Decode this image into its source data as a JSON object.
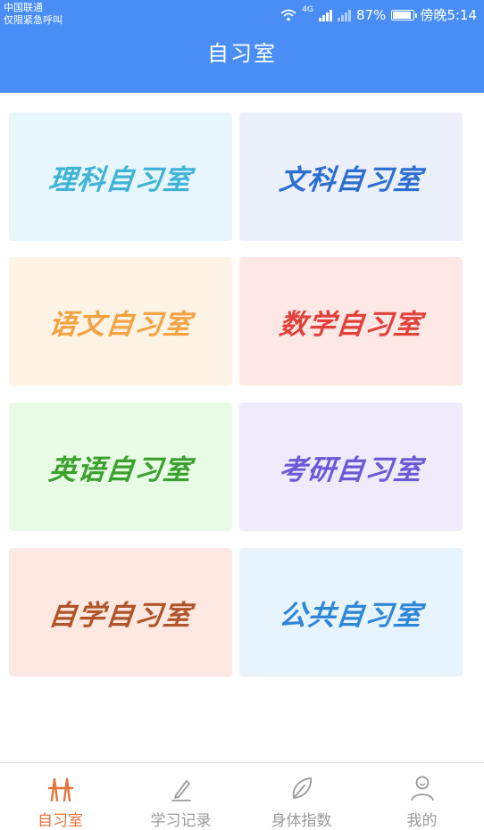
{
  "status_bar": {
    "carrier": "中国联通",
    "emergency": "仅限紧急呼叫",
    "network": "4G",
    "battery": "87%",
    "time": "傍晚5:14"
  },
  "header": {
    "title": "自习室"
  },
  "rooms": [
    {
      "label": "理科自习室",
      "color": "#3fb3d6",
      "bg": "#e7f6fd"
    },
    {
      "label": "文科自习室",
      "color": "#2c6fd1",
      "bg": "#ecf0fb"
    },
    {
      "label": "语文自习室",
      "color": "#f3a342",
      "bg": "#fff3e6"
    },
    {
      "label": "数学自习室",
      "color": "#e2413a",
      "bg": "#fde8e6"
    },
    {
      "label": "英语自习室",
      "color": "#3aa02e",
      "bg": "#e8fbe4"
    },
    {
      "label": "考研自习室",
      "color": "#6b5ad6",
      "bg": "#efebfc"
    },
    {
      "label": "自学自习室",
      "color": "#b0542a",
      "bg": "#fde9e2"
    },
    {
      "label": "公共自习室",
      "color": "#2d86d8",
      "bg": "#e7f4fd"
    }
  ],
  "tabs": [
    {
      "label": "自习室",
      "icon": "study-room-icon",
      "active": true
    },
    {
      "label": "学习记录",
      "icon": "pen-icon",
      "active": false
    },
    {
      "label": "身体指数",
      "icon": "leaf-icon",
      "active": false
    },
    {
      "label": "我的",
      "icon": "user-icon",
      "active": false
    }
  ],
  "colors": {
    "primary": "#4a8ef5",
    "tab_active": "#e8723a",
    "tab_inactive": "#9a9a9a"
  }
}
